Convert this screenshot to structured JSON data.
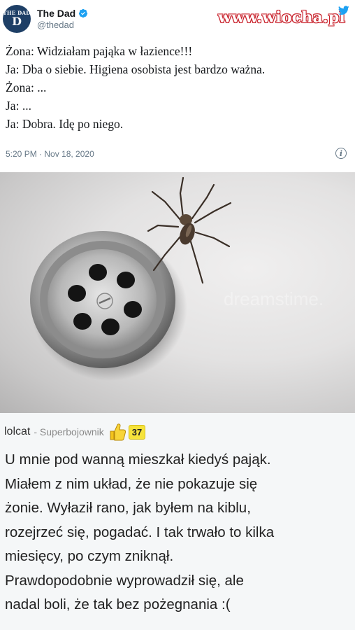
{
  "tweet": {
    "avatar_line1": "THE DAD",
    "avatar_line2": "D",
    "display_name": "The Dad",
    "handle": "@thedad",
    "lines": [
      "Żona: Widziałam pająka w łazience!!!",
      "Ja: Dba o siebie. Higiena osobista jest bardzo ważna.",
      "Żona: ...",
      "Ja: ...",
      "Ja: Dobra. Idę po niego."
    ],
    "timestamp": "5:20 PM · Nov 18, 2020",
    "info_label": "i"
  },
  "watermark": "www.wiocha.pl",
  "image": {
    "stock_watermark": "dreamstime."
  },
  "comment": {
    "username": "lolcat",
    "rank": "- Superbojownik",
    "score": "37",
    "lines": [
      "U mnie pod wanną mieszkał kiedyś pająk.",
      "Miałem z nim układ, że nie pokazuje się",
      "żonie. Wyłaził rano, jak byłem na kiblu,",
      "rozejrzeć się, pogadać. I tak trwało to kilka",
      "miesięcy, po czym zniknął.",
      "Prawdopodobnie wyprowadził się, ale",
      "nadal boli, że tak bez pożegnania :("
    ]
  },
  "colors": {
    "twitter_blue": "#1da1f2",
    "watermark_red": "#c8202a",
    "score_yellow": "#f6e33b"
  }
}
